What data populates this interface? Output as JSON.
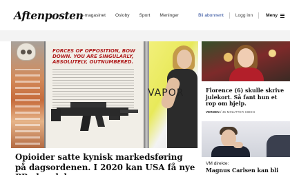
{
  "header": {
    "logo": "Aftenposten",
    "nav": [
      "A-magasinet",
      "Osloby",
      "Sport",
      "Meninger"
    ],
    "subscribe_label": "Bli abonnent",
    "login_label": "Logg inn",
    "menu_label": "Meny"
  },
  "main_article": {
    "image": {
      "headline": "Forces of opposition, bow down. You are singularly, absolutely, outnumbered.",
      "brand_text": "VAPOR"
    },
    "title": "Opioider satte kynisk markedsføring på dagsordenen. I 2020 kan USA få nye PR-skandaler"
  },
  "side_articles": [
    {
      "title": "Florence (6) skulle skrive julekort. Så fant hun et rop om hjelp.",
      "section": "VERDEN",
      "time": "45 MINUTTER SIDEN"
    },
    {
      "label": "VM direkte:",
      "title": "Magnus Carlsen kan bli"
    }
  ],
  "colors": {
    "subscribe": "#2a4a9a",
    "background": "#f3f3f3"
  }
}
